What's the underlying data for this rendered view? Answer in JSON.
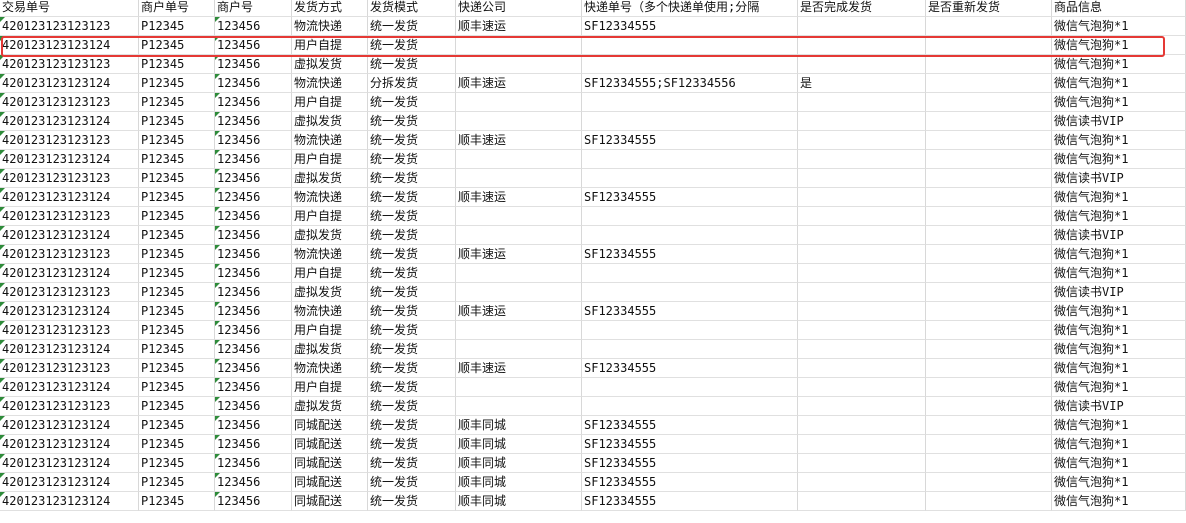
{
  "highlight_color": "#e53935",
  "headers": [
    "交易单号",
    "商户单号",
    "商户号",
    "发货方式",
    "发货模式",
    "快递公司",
    "快递单号（多个快递单使用;分隔",
    "是否完成发货",
    "是否重新发货",
    "商品信息"
  ],
  "rows": [
    [
      "420123123123123",
      "P12345",
      "123456",
      "物流快递",
      "统一发货",
      "顺丰速运",
      "SF12334555",
      "",
      "",
      "微信气泡狗*1"
    ],
    [
      "420123123123124",
      "P12345",
      "123456",
      "用户自提",
      "统一发货",
      "",
      "",
      "",
      "",
      "微信气泡狗*1"
    ],
    [
      "420123123123123",
      "P12345",
      "123456",
      "虚拟发货",
      "统一发货",
      "",
      "",
      "",
      "",
      "微信气泡狗*1"
    ],
    [
      "420123123123124",
      "P12345",
      "123456",
      "物流快递",
      "分拆发货",
      "顺丰速运",
      "SF12334555;SF12334556",
      "是",
      "",
      "微信气泡狗*1"
    ],
    [
      "420123123123123",
      "P12345",
      "123456",
      "用户自提",
      "统一发货",
      "",
      "",
      "",
      "",
      "微信气泡狗*1"
    ],
    [
      "420123123123124",
      "P12345",
      "123456",
      "虚拟发货",
      "统一发货",
      "",
      "",
      "",
      "",
      "微信读书VIP"
    ],
    [
      "420123123123123",
      "P12345",
      "123456",
      "物流快递",
      "统一发货",
      "顺丰速运",
      "SF12334555",
      "",
      "",
      "微信气泡狗*1"
    ],
    [
      "420123123123124",
      "P12345",
      "123456",
      "用户自提",
      "统一发货",
      "",
      "",
      "",
      "",
      "微信气泡狗*1"
    ],
    [
      "420123123123123",
      "P12345",
      "123456",
      "虚拟发货",
      "统一发货",
      "",
      "",
      "",
      "",
      "微信读书VIP"
    ],
    [
      "420123123123124",
      "P12345",
      "123456",
      "物流快递",
      "统一发货",
      "顺丰速运",
      "SF12334555",
      "",
      "",
      "微信气泡狗*1"
    ],
    [
      "420123123123123",
      "P12345",
      "123456",
      "用户自提",
      "统一发货",
      "",
      "",
      "",
      "",
      "微信气泡狗*1"
    ],
    [
      "420123123123124",
      "P12345",
      "123456",
      "虚拟发货",
      "统一发货",
      "",
      "",
      "",
      "",
      "微信读书VIP"
    ],
    [
      "420123123123123",
      "P12345",
      "123456",
      "物流快递",
      "统一发货",
      "顺丰速运",
      "SF12334555",
      "",
      "",
      "微信气泡狗*1"
    ],
    [
      "420123123123124",
      "P12345",
      "123456",
      "用户自提",
      "统一发货",
      "",
      "",
      "",
      "",
      "微信气泡狗*1"
    ],
    [
      "420123123123123",
      "P12345",
      "123456",
      "虚拟发货",
      "统一发货",
      "",
      "",
      "",
      "",
      "微信读书VIP"
    ],
    [
      "420123123123124",
      "P12345",
      "123456",
      "物流快递",
      "统一发货",
      "顺丰速运",
      "SF12334555",
      "",
      "",
      "微信气泡狗*1"
    ],
    [
      "420123123123123",
      "P12345",
      "123456",
      "用户自提",
      "统一发货",
      "",
      "",
      "",
      "",
      "微信气泡狗*1"
    ],
    [
      "420123123123124",
      "P12345",
      "123456",
      "虚拟发货",
      "统一发货",
      "",
      "",
      "",
      "",
      "微信气泡狗*1"
    ],
    [
      "420123123123123",
      "P12345",
      "123456",
      "物流快递",
      "统一发货",
      "顺丰速运",
      "SF12334555",
      "",
      "",
      "微信气泡狗*1"
    ],
    [
      "420123123123124",
      "P12345",
      "123456",
      "用户自提",
      "统一发货",
      "",
      "",
      "",
      "",
      "微信气泡狗*1"
    ],
    [
      "420123123123123",
      "P12345",
      "123456",
      "虚拟发货",
      "统一发货",
      "",
      "",
      "",
      "",
      "微信读书VIP"
    ],
    [
      "420123123123124",
      "P12345",
      "123456",
      "同城配送",
      "统一发货",
      "顺丰同城",
      "SF12334555",
      "",
      "",
      "微信气泡狗*1"
    ],
    [
      "420123123123124",
      "P12345",
      "123456",
      "同城配送",
      "统一发货",
      "顺丰同城",
      "SF12334555",
      "",
      "",
      "微信气泡狗*1"
    ],
    [
      "420123123123124",
      "P12345",
      "123456",
      "同城配送",
      "统一发货",
      "顺丰同城",
      "SF12334555",
      "",
      "",
      "微信气泡狗*1"
    ],
    [
      "420123123123124",
      "P12345",
      "123456",
      "同城配送",
      "统一发货",
      "顺丰同城",
      "SF12334555",
      "",
      "",
      "微信气泡狗*1"
    ],
    [
      "420123123123124",
      "P12345",
      "123456",
      "同城配送",
      "统一发货",
      "顺丰同城",
      "SF12334555",
      "",
      "",
      "微信气泡狗*1"
    ]
  ]
}
